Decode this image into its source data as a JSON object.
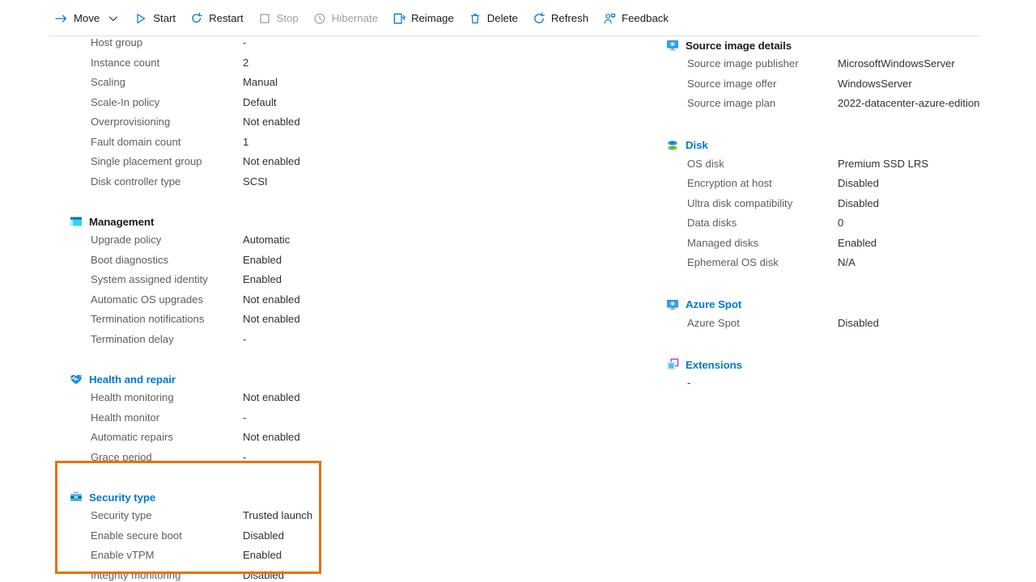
{
  "toolbar": {
    "items": [
      {
        "label": "Move",
        "icon": "arrow-right-icon",
        "disabled": false,
        "chevron": true
      },
      {
        "label": "Start",
        "icon": "play-icon",
        "disabled": false,
        "chevron": false
      },
      {
        "label": "Restart",
        "icon": "restart-icon",
        "disabled": false,
        "chevron": false
      },
      {
        "label": "Stop",
        "icon": "stop-square-icon",
        "disabled": true,
        "chevron": false
      },
      {
        "label": "Hibernate",
        "icon": "clock-icon",
        "disabled": true,
        "chevron": false
      },
      {
        "label": "Reimage",
        "icon": "reimage-icon",
        "disabled": false,
        "chevron": false
      },
      {
        "label": "Delete",
        "icon": "trash-icon",
        "disabled": false,
        "chevron": false
      },
      {
        "label": "Refresh",
        "icon": "refresh-icon",
        "disabled": false,
        "chevron": false
      },
      {
        "label": "Feedback",
        "icon": "feedback-icon",
        "disabled": false,
        "chevron": false
      }
    ]
  },
  "colors": {
    "accent_blue": "#0078d4",
    "highlight_orange": "#e8720c",
    "label_gray": "#605e5c",
    "value_dark": "#323130",
    "disabled_gray": "#a19f9d"
  },
  "left_column": {
    "top_rows": [
      {
        "label": "Host group",
        "value": "-"
      },
      {
        "label": "Instance count",
        "value": "2"
      },
      {
        "label": "Scaling",
        "value": "Manual"
      },
      {
        "label": "Scale-In policy",
        "value": "Default"
      },
      {
        "label": "Overprovisioning",
        "value": "Not enabled"
      },
      {
        "label": "Fault domain count",
        "value": "1"
      },
      {
        "label": "Single placement group",
        "value": "Not enabled"
      },
      {
        "label": "Disk controller type",
        "value": "SCSI"
      }
    ],
    "sections": [
      {
        "title": "Management",
        "icon": "management-window-icon",
        "is_link": false,
        "rows": [
          {
            "label": "Upgrade policy",
            "value": "Automatic"
          },
          {
            "label": "Boot diagnostics",
            "value": "Enabled"
          },
          {
            "label": "System assigned identity",
            "value": "Enabled"
          },
          {
            "label": "Automatic OS upgrades",
            "value": "Not enabled"
          },
          {
            "label": "Termination notifications",
            "value": "Not enabled"
          },
          {
            "label": "Termination delay",
            "value": "-"
          }
        ]
      },
      {
        "title": "Health and repair",
        "icon": "heart-pulse-icon",
        "is_link": true,
        "rows": [
          {
            "label": "Health monitoring",
            "value": "Not enabled"
          },
          {
            "label": "Health monitor",
            "value": "-"
          },
          {
            "label": "Automatic repairs",
            "value": "Not enabled"
          },
          {
            "label": "Grace period",
            "value": "-"
          }
        ]
      },
      {
        "title": "Security type",
        "icon": "toolbox-icon",
        "is_link": true,
        "highlighted": true,
        "rows": [
          {
            "label": "Security type",
            "value": "Trusted launch"
          },
          {
            "label": "Enable secure boot",
            "value": "Disabled"
          },
          {
            "label": "Enable vTPM",
            "value": "Enabled"
          },
          {
            "label": "Integrity monitoring",
            "value": "Disabled"
          }
        ]
      }
    ]
  },
  "right_column": {
    "sections": [
      {
        "title": "Source image details",
        "icon": "monitor-icon",
        "is_link": false,
        "rows": [
          {
            "label": "Source image publisher",
            "value": "MicrosoftWindowsServer"
          },
          {
            "label": "Source image offer",
            "value": "WindowsServer"
          },
          {
            "label": "Source image plan",
            "value": "2022-datacenter-azure-edition"
          }
        ]
      },
      {
        "title": "Disk",
        "icon": "disk-stack-icon",
        "is_link": true,
        "rows": [
          {
            "label": "OS disk",
            "value": "Premium SSD LRS"
          },
          {
            "label": "Encryption at host",
            "value": "Disabled"
          },
          {
            "label": "Ultra disk compatibility",
            "value": "Disabled"
          },
          {
            "label": "Data disks",
            "value": "0"
          },
          {
            "label": "Managed disks",
            "value": "Enabled"
          },
          {
            "label": "Ephemeral OS disk",
            "value": "N/A"
          }
        ]
      },
      {
        "title": "Azure Spot",
        "icon": "monitor-icon",
        "is_link": true,
        "rows": [
          {
            "label": "Azure Spot",
            "value": "Disabled"
          }
        ]
      },
      {
        "title": "Extensions",
        "icon": "extensions-icon",
        "is_link": true,
        "rows": [],
        "empty_value": "-"
      }
    ]
  }
}
